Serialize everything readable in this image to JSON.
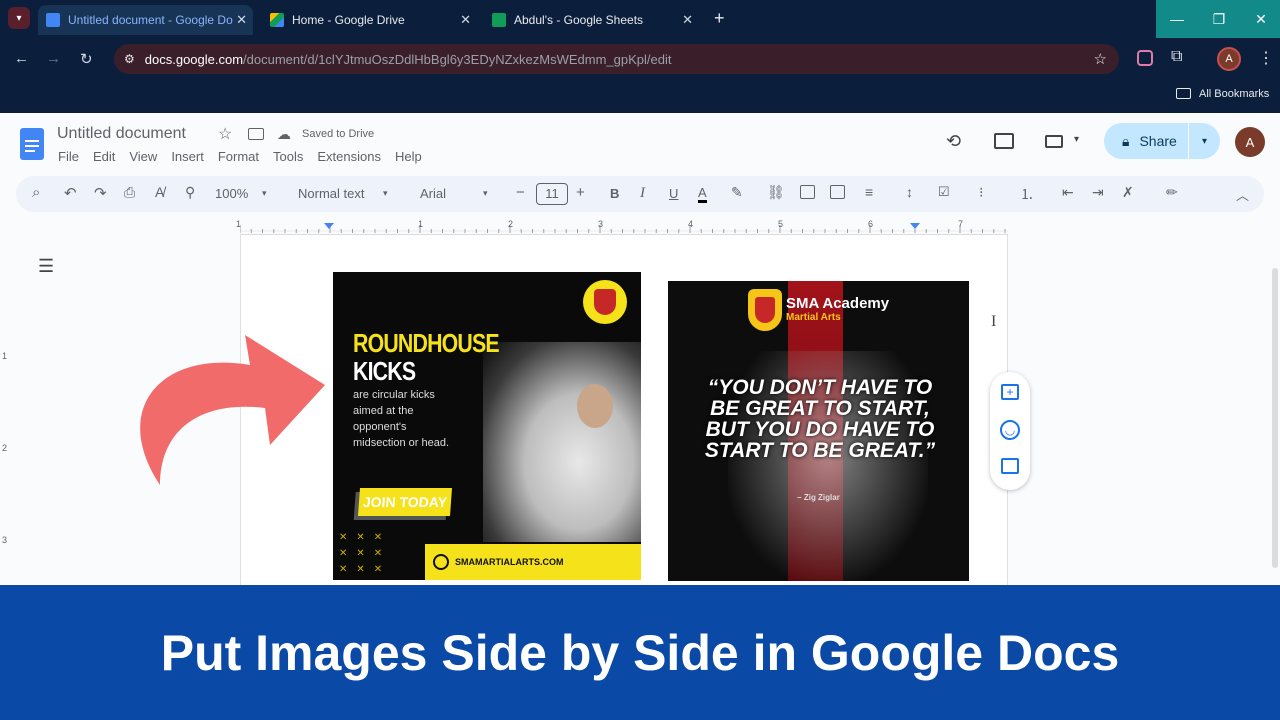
{
  "browser": {
    "tabs": [
      {
        "label": "Untitled document - Google Do",
        "active": true,
        "favicon_color": "#4285f4"
      },
      {
        "label": "Home - Google Drive",
        "active": false,
        "favicon_color": "#fbbc04"
      },
      {
        "label": "Abdul's - Google Sheets",
        "active": false,
        "favicon_color": "#0f9d58"
      }
    ],
    "new_tab": "+",
    "window_controls": [
      "—",
      "❐",
      "✕"
    ],
    "url_host": "docs.google.com",
    "url_path": "/document/d/1clYJtmuOszDdlHbBgl6y3EDyNZxkezMsWEdmm_gpKpl/edit",
    "bookmarks_label": "All Bookmarks",
    "profile_initial": "A"
  },
  "docs": {
    "title": "Untitled document",
    "saved_status": "Saved to Drive",
    "menu": [
      "File",
      "Edit",
      "View",
      "Insert",
      "Format",
      "Tools",
      "Extensions",
      "Help"
    ],
    "share_label": "Share",
    "avatar_initial": "A",
    "toolbar": {
      "zoom": "100%",
      "style": "Normal text",
      "font": "Arial",
      "font_size": "11"
    },
    "ruler_marks": [
      "1",
      "1",
      "2",
      "3",
      "4",
      "5",
      "6",
      "7"
    ],
    "vruler_marks": [
      "1",
      "2",
      "3"
    ]
  },
  "image_left": {
    "headline_1": "ROUNDHOUSE",
    "headline_2": "KICKS",
    "body": "are circular kicks aimed at the opponent's midsection or head.",
    "cta": "JOIN TODAY",
    "website": "SMAMARTIALARTS.COM"
  },
  "image_right": {
    "brand": "SMA Academy",
    "brand_sub": "Martial Arts",
    "quote": "“YOU DON’T HAVE TO BE GREAT TO START, BUT YOU DO HAVE TO START TO BE GREAT.”",
    "author": "– Zig Ziglar"
  },
  "banner": {
    "text": "Put Images Side by Side in Google Docs"
  },
  "colors": {
    "accent_yellow": "#f5e21b",
    "arrow_red": "#f26b6b",
    "banner_blue": "#0a4aa6",
    "share_bg": "#c2e7ff"
  }
}
